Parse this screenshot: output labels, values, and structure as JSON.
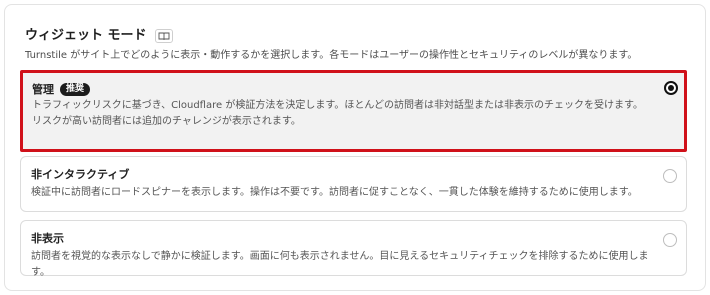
{
  "section": {
    "title": "ウィジェット モード",
    "description": "Turnstile がサイト上でどのように表示・動作するかを選択します。各モードはユーザーの操作性とセキュリティのレベルが異なります。",
    "doc_icon": "book-icon"
  },
  "options": [
    {
      "title": "管理",
      "badge": "推奨",
      "description": "トラフィックリスクに基づき、Cloudflare が検証方法を決定します。ほとんどの訪問者は非対話型または非表示のチェックを受けます。リスクが高い訪問者には追加のチャレンジが表示されます。",
      "selected": true
    },
    {
      "title": "非インタラクティブ",
      "description": "検証中に訪問者にロードスピナーを表示します。操作は不要です。訪問者に促すことなく、一貫した体験を維持するために使用します。",
      "selected": false
    },
    {
      "title": "非表示",
      "description": "訪問者を視覚的な表示なしで静かに検証します。画面に何も表示されません。目に見えるセキュリティチェックを排除するために使用します。",
      "selected": false
    }
  ],
  "colors": {
    "highlight_border": "#d0111a",
    "badge_bg": "#1c1c1c",
    "selected_bg": "#f2f2f2"
  }
}
